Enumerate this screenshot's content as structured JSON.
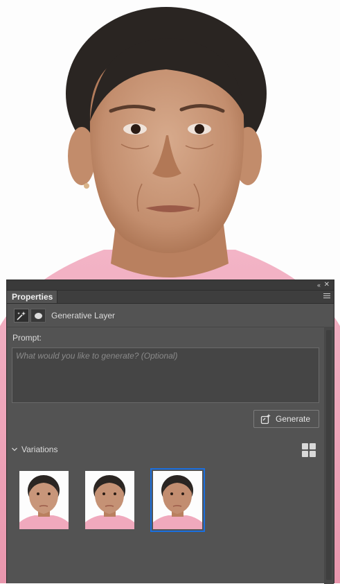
{
  "panel": {
    "title": "Properties",
    "collapse_glyph": "‹‹",
    "close_glyph": "✕",
    "menu_icon": "hamburger-menu-icon"
  },
  "layer": {
    "type_icon": "generative-layer-icon",
    "mask_icon": "layer-mask-icon",
    "name": "Generative Layer"
  },
  "prompt": {
    "label": "Prompt:",
    "placeholder": "What would you like to generate? (Optional)",
    "value": ""
  },
  "generate_button": {
    "label": "Generate",
    "icon": "generate-sparkle-icon"
  },
  "variations": {
    "label": "Variations",
    "expanded": true,
    "view_icon": "grid-view-icon",
    "selected_index": 2,
    "count": 3
  },
  "colors": {
    "panel_bg": "#535353",
    "selection_blue": "#1a6fe0",
    "shirt_pink": "#f0a9bd"
  }
}
